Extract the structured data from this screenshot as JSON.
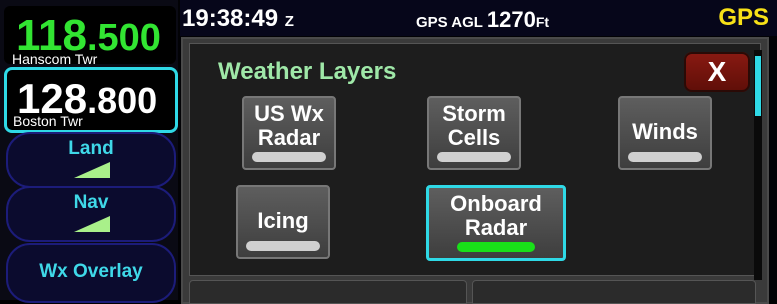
{
  "left_panel": {
    "active_freq": {
      "int": "118",
      "dec": ".500",
      "label": "Hanscom Twr",
      "color": "#32e532"
    },
    "standby_freq": {
      "int": "128",
      "dec": ".800",
      "label": "Boston Twr"
    },
    "buttons": [
      {
        "label": "Land"
      },
      {
        "label": "Nav"
      },
      {
        "label": "Wx Overlay"
      }
    ]
  },
  "topbar": {
    "time": "19:38:49",
    "time_zone": "Z",
    "agl_label": "GPS AGL",
    "agl_value": "1270",
    "agl_unit": "Ft",
    "nav_source": "GPS",
    "nav_source_color": "#f7e017"
  },
  "dialog": {
    "title": "Weather Layers",
    "close_label": "X",
    "layers": [
      {
        "line1": "US Wx",
        "line2": "Radar",
        "active": false
      },
      {
        "line1": "Storm",
        "line2": "Cells",
        "active": false
      },
      {
        "line1": "Winds",
        "line2": "",
        "active": false
      },
      {
        "line1": "Icing",
        "line2": "",
        "active": false
      },
      {
        "line1": "Onboard",
        "line2": "Radar",
        "active": true
      }
    ]
  },
  "colors": {
    "accent": "#2fd9e6",
    "title_green": "#9fe8a8",
    "close_red": "#8a1a12",
    "active_indicator": "#19e019"
  }
}
